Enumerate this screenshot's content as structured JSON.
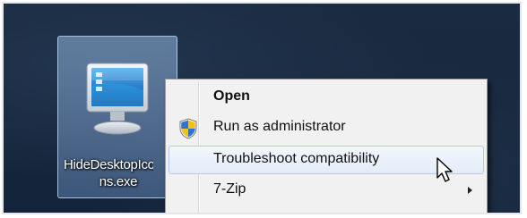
{
  "desktop_icon": {
    "label_line1": "HideDesktopIco",
    "label_line2": "ns.exe",
    "icon": "monitor-icon"
  },
  "context_menu": {
    "items": [
      {
        "label": "Open",
        "bold": true,
        "icon": null,
        "submenu": false
      },
      {
        "label": "Run as administrator",
        "bold": false,
        "icon": "uac-shield-icon",
        "submenu": false
      },
      {
        "label": "Troubleshoot compatibility",
        "bold": false,
        "icon": null,
        "submenu": false,
        "highlighted": true
      },
      {
        "label": "7-Zip",
        "bold": false,
        "icon": null,
        "submenu": true
      }
    ]
  },
  "cursor": {
    "icon": "mouse-pointer-icon"
  },
  "colors": {
    "desktop_bg": "#152640",
    "menu_bg": "#f1f1f1",
    "hover_border": "#b4cbe8",
    "selection_bg": "#8fb2dc"
  }
}
